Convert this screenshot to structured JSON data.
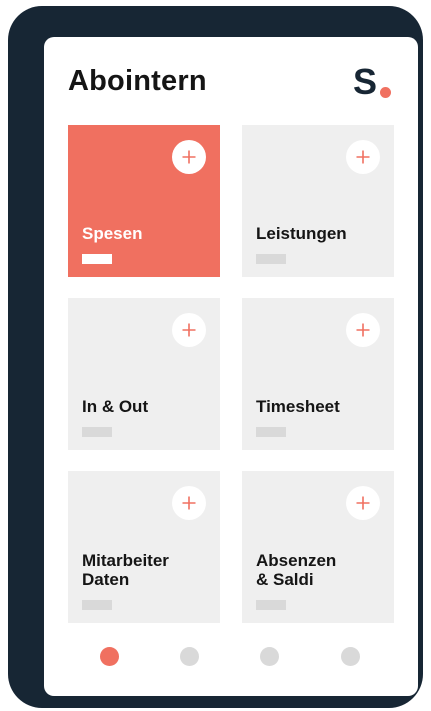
{
  "app": {
    "title": "Abointern",
    "brand_mark": "S",
    "accent_color": "#f07060",
    "frame_color": "#172634"
  },
  "tiles": [
    {
      "label": "Spesen",
      "active": true,
      "icon": "plus-icon"
    },
    {
      "label": "Leistungen",
      "active": false,
      "icon": "plus-icon"
    },
    {
      "label": "In & Out",
      "active": false,
      "icon": "plus-icon"
    },
    {
      "label": "Timesheet",
      "active": false,
      "icon": "plus-icon"
    },
    {
      "label": "Mitarbeiter\nDaten",
      "active": false,
      "icon": "plus-icon"
    },
    {
      "label": "Absenzen\n& Saldi",
      "active": false,
      "icon": "plus-icon"
    }
  ],
  "pager": {
    "pages": 4,
    "current": 1
  }
}
